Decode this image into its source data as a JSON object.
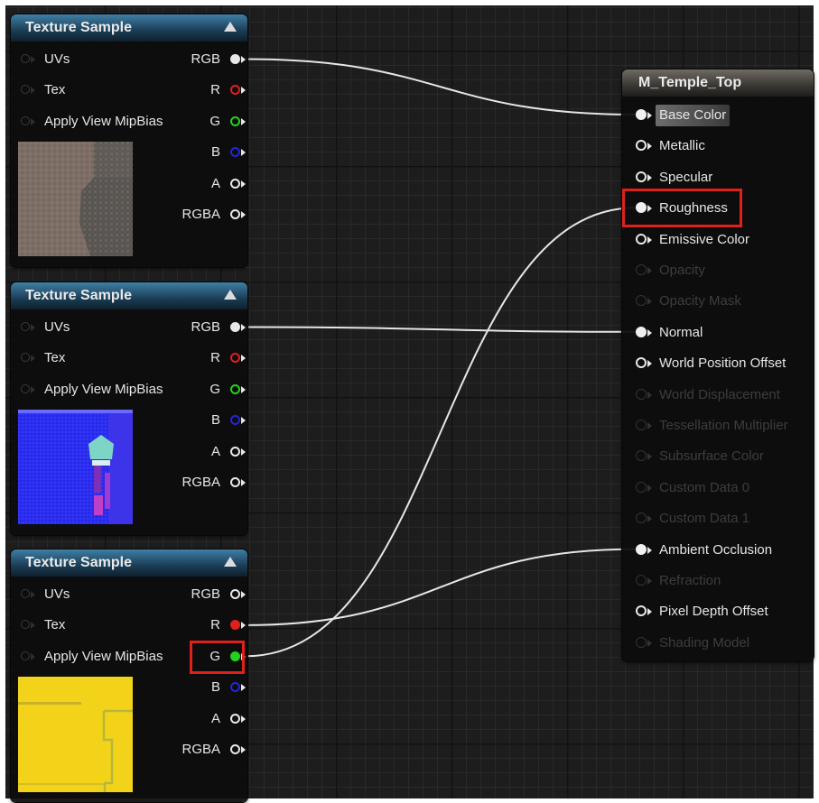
{
  "nodes": {
    "tex1": {
      "title": "Texture Sample",
      "inputs": [
        "UVs",
        "Tex",
        "Apply View MipBias"
      ],
      "outputs": [
        {
          "label": "RGB",
          "color": "#e8e8e8",
          "connected": true
        },
        {
          "label": "R",
          "color": "#e0201b",
          "connected": false
        },
        {
          "label": "G",
          "color": "#22d21e",
          "connected": false
        },
        {
          "label": "B",
          "color": "#2326d6",
          "connected": false
        },
        {
          "label": "A",
          "color": "#e8e8e8",
          "connected": false
        },
        {
          "label": "RGBA",
          "color": "#e8e8e8",
          "connected": false
        }
      ],
      "thumbnail": "base-color-texture"
    },
    "tex2": {
      "title": "Texture Sample",
      "inputs": [
        "UVs",
        "Tex",
        "Apply View MipBias"
      ],
      "outputs": [
        {
          "label": "RGB",
          "color": "#e8e8e8",
          "connected": true
        },
        {
          "label": "R",
          "color": "#e0201b",
          "connected": false
        },
        {
          "label": "G",
          "color": "#22d21e",
          "connected": false
        },
        {
          "label": "B",
          "color": "#2326d6",
          "connected": false
        },
        {
          "label": "A",
          "color": "#e8e8e8",
          "connected": false
        },
        {
          "label": "RGBA",
          "color": "#e8e8e8",
          "connected": false
        }
      ],
      "thumbnail": "normal-map-texture"
    },
    "tex3": {
      "title": "Texture Sample",
      "inputs": [
        "UVs",
        "Tex",
        "Apply View MipBias"
      ],
      "outputs": [
        {
          "label": "RGB",
          "color": "#e8e8e8",
          "connected": false
        },
        {
          "label": "R",
          "color": "#e0201b",
          "connected": true
        },
        {
          "label": "G",
          "color": "#22d21e",
          "connected": true
        },
        {
          "label": "B",
          "color": "#2326d6",
          "connected": false
        },
        {
          "label": "A",
          "color": "#e8e8e8",
          "connected": false
        },
        {
          "label": "RGBA",
          "color": "#e8e8e8",
          "connected": false
        }
      ],
      "thumbnail": "packed-mask-texture"
    },
    "material": {
      "title": "M_Temple_Top",
      "inputs": [
        {
          "label": "Base Color",
          "enabled": true,
          "connected": true
        },
        {
          "label": "Metallic",
          "enabled": true,
          "connected": false
        },
        {
          "label": "Specular",
          "enabled": true,
          "connected": false
        },
        {
          "label": "Roughness",
          "enabled": true,
          "connected": true
        },
        {
          "label": "Emissive Color",
          "enabled": true,
          "connected": false
        },
        {
          "label": "Opacity",
          "enabled": false,
          "connected": false
        },
        {
          "label": "Opacity Mask",
          "enabled": false,
          "connected": false
        },
        {
          "label": "Normal",
          "enabled": true,
          "connected": true
        },
        {
          "label": "World Position Offset",
          "enabled": true,
          "connected": false
        },
        {
          "label": "World Displacement",
          "enabled": false,
          "connected": false
        },
        {
          "label": "Tessellation Multiplier",
          "enabled": false,
          "connected": false
        },
        {
          "label": "Subsurface Color",
          "enabled": false,
          "connected": false
        },
        {
          "label": "Custom Data 0",
          "enabled": false,
          "connected": false
        },
        {
          "label": "Custom Data 1",
          "enabled": false,
          "connected": false
        },
        {
          "label": "Ambient Occlusion",
          "enabled": true,
          "connected": true
        },
        {
          "label": "Refraction",
          "enabled": false,
          "connected": false
        },
        {
          "label": "Pixel Depth Offset",
          "enabled": true,
          "connected": false
        },
        {
          "label": "Shading Model",
          "enabled": false,
          "connected": false
        }
      ]
    }
  },
  "connections": [
    {
      "from": "tex1.RGB",
      "to": "material.Base Color"
    },
    {
      "from": "tex2.RGB",
      "to": "material.Normal"
    },
    {
      "from": "tex3.R",
      "to": "material.Ambient Occlusion"
    },
    {
      "from": "tex3.G",
      "to": "material.Roughness"
    }
  ],
  "highlights": [
    "material.Roughness",
    "tex3.G"
  ],
  "colors": {
    "canvas_bg": "#1d1d1d",
    "node_bg": "#0d0d0d",
    "texture_header": "#2a5a7a",
    "material_header": "#4d4943",
    "pin_white": "#e8e8e8",
    "pin_red": "#e0201b",
    "pin_green": "#22d21e",
    "pin_blue": "#2326d6",
    "highlight": "#e0201b",
    "wire": "#e6e6e6"
  }
}
